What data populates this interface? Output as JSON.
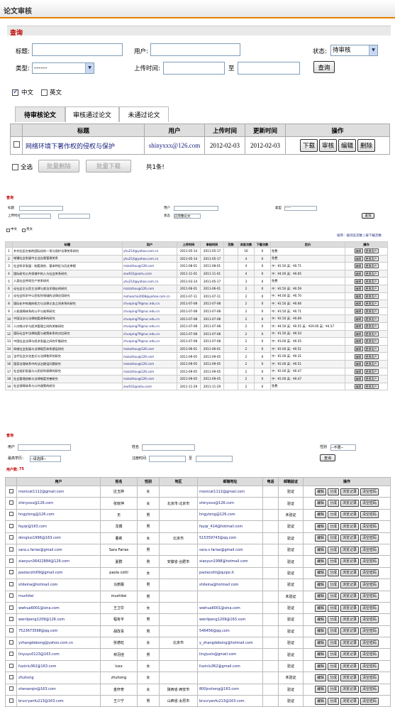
{
  "section1": {
    "title": "论文审核",
    "search_header": "查询",
    "title_label": "标题:",
    "user_label": "用户:",
    "status_label": "状态:",
    "status_value": "待审核",
    "type_label": "类型:",
    "type_value": "------",
    "upload_time_label": "上传时间:",
    "to_label": "至",
    "search_button": "查询",
    "lang_chinese": "中文",
    "lang_english": "英文",
    "tabs": [
      "待审核论文",
      "审核通过论文",
      "未通过论文"
    ],
    "columns": [
      "标题",
      "用户",
      "上传时间",
      "更新时间",
      "操作"
    ],
    "row": {
      "title": "网络环境下著作权的侵权与保护",
      "user": "shinyxxx@126.com",
      "uploaded": "2012-02-03",
      "updated": "2012-02-03"
    },
    "row_actions": [
      "下载",
      "审核",
      "编辑",
      "删除"
    ],
    "select_all": "全选",
    "batch_delete": "批量删除",
    "batch_download": "批量下载",
    "total": "共1条!"
  },
  "section2": {
    "search_header": "查询",
    "title_label": "标题",
    "user_label": "用户",
    "type_label": "类型",
    "type_value": "-----",
    "upload_time_label": "上传时间",
    "status_label": "状态",
    "status_value": "已完整论文",
    "search_button": "查询",
    "lang_chinese": "中文",
    "lang_english": "英文",
    "top_right_links": "排序：按浏览次数 | 按下载次数",
    "columns": [
      "",
      "标题",
      "用户",
      "上传时间",
      "审核时间",
      "页数",
      "浏览次数",
      "下载次数",
      "定价",
      "操作"
    ],
    "row_actions": [
      "编辑",
      "更换用户"
    ],
    "rows": [
      [
        "1",
        "乡村社区在新的国际化的一项与保护法律关系研究",
        "yhu214@yahoo.com.cn",
        "2011-05-14",
        "2011-05-17",
        "",
        "16",
        "0",
        "免费"
      ],
      [
        "2",
        "城镇社会发展中企业自我管理关系",
        "yhu214@yahoo.com.cn",
        "2011-05-14",
        "2011-05-17",
        "",
        "4",
        "0",
        "免费"
      ],
      [
        "3",
        "社会科学发展：制度改良、基本特征与历史审视",
        "mzzzzhou@126.com",
        "2011-08-01",
        "2011-08-01",
        "",
        "4",
        "0",
        "中：¥2.50 英：¥0.71"
      ],
      [
        "4",
        "国际研究公共领域中的人与社会关系研究",
        "zeu931@sohu.com",
        "2011-11-01",
        "2011-11-01",
        "",
        "4",
        "0",
        "中：¥4.00 英：¥0.65"
      ],
      [
        "5",
        "人类社会并网生产关系研究",
        "yhu214@yahoo.com.cn",
        "2011-03-14",
        "2011-05-17",
        "",
        "3",
        "0",
        "免费"
      ],
      [
        "6",
        "论社会主义民主法律与其法学理论的研究",
        "mzzzzhou@126.com",
        "2011-06-01",
        "2011-06-01",
        "",
        "2",
        "0",
        "中：¥2.50 英：¥0.59"
      ],
      [
        "7",
        "论社会科学中公民权利领域的法律应用研究",
        "mshaocha2008@yahoo.com.cn",
        "2011-07-11",
        "2011-07-11",
        "",
        "2",
        "0",
        "中：¥4.00 英：¥0.70"
      ],
      [
        "8",
        "国际化中的政府权力与法律义务之间关系的研究",
        "chunping79@ruc.edu.cn",
        "2011-07-08",
        "2011-07-08",
        "",
        "2",
        "0",
        "中：¥2.50 英：¥0.66"
      ],
      [
        "9",
        "人权保障体系的公平与效率研究",
        "chunping79@ruc.edu.cn",
        "2011-07-08",
        "2011-07-08",
        "",
        "2",
        "0",
        "中：¥3.50 英：¥0.71"
      ],
      [
        "10",
        "中国法治与法律制度改革的研究",
        "chunping79@ruc.edu.cn",
        "2011-07-08",
        "2011-07-08",
        "",
        "2",
        "0",
        "中：¥2.50 英：¥0.69"
      ],
      [
        "11",
        "人口统计学与经济管理之间的关联研究",
        "chunping79@ruc.edu.cn",
        "2011-07-08",
        "2011-07-08",
        "",
        "2",
        "0",
        "中：¥4.50 英：¥0.55 英：¥29.00 英：¥4.57"
      ],
      [
        "12",
        "国际社会中法律制度与政策体系的对比研究",
        "chunping79@ruc.edu.cn",
        "2011-07-08",
        "2011-07-08",
        "",
        "2",
        "0",
        "中：¥1.50 英：¥0.54"
      ],
      [
        "13",
        "中国社会法律与经济发展之间的平衡研究",
        "chunping79@ruc.edu.cn",
        "2011-07-08",
        "2011-07-08",
        "",
        "2",
        "0",
        "中：¥3.00 英：¥0.55"
      ],
      [
        "14",
        "网络社会发展与法律规范体系建设研究",
        "mzzzzhou@126.com",
        "2011-06-01",
        "2011-06-01",
        "",
        "2",
        "0",
        "中：¥2.00 英：¥0.51"
      ],
      [
        "15",
        "当代社会文化变迁与法律秩序的研究",
        "mzzzzhou@126.com",
        "2011-09-05",
        "2011-09-05",
        "",
        "2",
        "0",
        "中：¥2.00 英：¥0.31"
      ],
      [
        "16",
        "国家治理体系中的法治建设问题研究",
        "mzzzzhou@126.com",
        "2011-09-05",
        "2011-09-05",
        "",
        "2",
        "0",
        "中：¥2.00 英：¥0.51"
      ],
      [
        "17",
        "社会组织发展与公民权利保障的研究",
        "mzzzzhou@126.com",
        "2011-09-05",
        "2011-09-05",
        "",
        "2",
        "0",
        "中：¥2.00 英：¥0.47"
      ],
      [
        "18",
        "社会管理创新与法律制度完善研究",
        "mzzzzhou@126.com",
        "2011-09-05",
        "2011-09-05",
        "",
        "2",
        "0",
        "中：¥2.00 英：¥0.47"
      ],
      [
        "19",
        "社会保障体系与公共政策的研究",
        "zeu931@sohu.com",
        "2011-11-29",
        "2011-11-29",
        "",
        "2",
        "0",
        "免费"
      ]
    ]
  },
  "section3": {
    "search_header": "查询",
    "user_label": "用户",
    "name_label": "姓名",
    "gender_label": "性别",
    "gender_value": "--不限--",
    "edu_label": "最高学历：",
    "edu_value": "--请选择--",
    "register_time_label": "注册时间",
    "to_label": "至",
    "search_button": "查询",
    "user_count_label": "用户数：",
    "user_count": "75",
    "columns": [
      "",
      "用户",
      "姓名",
      "性别",
      "地区",
      "邮箱地址",
      "电话",
      "邮箱验证",
      "操作"
    ],
    "row_actions": [
      "编辑",
      "分成",
      "浏览记录",
      "清空密码"
    ],
    "rows": [
      [
        "monicat1112@gmail.com",
        "庄玉婷",
        "女",
        "",
        "monicat1112@gmail.com",
        "",
        "验证"
      ],
      [
        "shinyxxx@126.com",
        "张晓萍",
        "女",
        "北京市·北京市",
        "shinyxxx@126.com",
        "",
        "验证"
      ],
      [
        "hngytong@126.com",
        "无",
        "男",
        "",
        "hngytong@126.com",
        "",
        "未验证"
      ],
      [
        "fayqr@163.com",
        "龙蕴",
        "男",
        "",
        "fayqr_414@hotmail.com",
        "",
        "验证"
      ],
      [
        "dongluo1996@163.com",
        "董莉",
        "女",
        "北京市",
        "515359743@qq.com",
        "",
        "验证"
      ],
      [
        "sara.s.farias@gmail.com",
        "Sara Farias",
        "男",
        "",
        "sara.s.farias@gmail.com",
        "",
        "验证"
      ],
      [
        "xiaoyun36422884@126.com",
        "夏群",
        "男",
        "安徽省·合肥市",
        "xiaoyun1998@hotmail.com",
        "",
        "验证"
      ],
      [
        "paolacotti09@gmail.com",
        "paola cotti",
        "女",
        "",
        "paolacotti@quipo.it",
        "",
        "验证"
      ],
      [
        "shileina@hotmail.com",
        "马丽蕾",
        "男",
        "",
        "shileina@hotmail.com",
        "",
        "验证"
      ],
      [
        "mushitei",
        "mushitei",
        "男",
        "",
        "",
        "",
        "未验证"
      ],
      [
        "wwhua6001@sina.com",
        "王卫华",
        "女",
        "",
        "wwhua6001@sina.com",
        "",
        "验证"
      ],
      [
        "wenlipeng1209@126.com",
        "程有平",
        "男",
        "",
        "wenlipeng1209@163.com",
        "",
        "验证"
      ],
      [
        "7523673568@qq.com",
        "胡改青",
        "男",
        "",
        "546456@qq.com",
        "",
        "验证"
      ],
      [
        "yzhangdebong@yahoo.com.cn",
        "张德虹",
        "女",
        "北京市",
        "y_zhangdebong@hotmail.com",
        "",
        "验证"
      ],
      [
        "linyuyu0123@163.com",
        "林羽佳",
        "男",
        "",
        "linyjuxin@gmail.com",
        "",
        "验证"
      ],
      [
        "fuxinlu362@163.com",
        "luxx",
        "女",
        "",
        "fuxinlu362@gmail.com",
        "",
        "验证"
      ],
      [
        "zhuhong",
        "zhuhong",
        "女",
        "",
        "",
        "",
        "未验证"
      ],
      [
        "shenanqin@163.com",
        "金轩奇",
        "女",
        "陕西省·西安市",
        "800jnshong@163.com",
        "",
        "验证"
      ],
      [
        "brucryanfu213@163.com",
        "王少宁",
        "男",
        "山西省·太原市",
        "brucryanfu213@163.com",
        "",
        "验证"
      ]
    ]
  }
}
